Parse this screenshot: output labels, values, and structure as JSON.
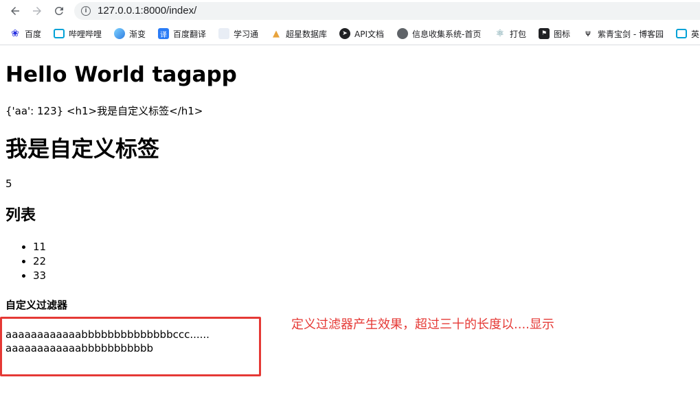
{
  "browser": {
    "url": "127.0.0.1:8000/index/",
    "bookmarks": [
      {
        "label": "百度",
        "icon": "baidu-paw-icon",
        "color": "#2932e1"
      },
      {
        "label": "哔哩哔哩",
        "icon": "bilibili-tv-icon",
        "color": "#00a1d6"
      },
      {
        "label": "渐变",
        "icon": "gradient-cube-icon",
        "color": "#4a90e2"
      },
      {
        "label": "百度翻译",
        "icon": "translate-icon",
        "color": "#2b7cf6"
      },
      {
        "label": "学习通",
        "icon": "blank-page-icon",
        "color": "#e8edf5"
      },
      {
        "label": "超星数据库",
        "icon": "chaoxing-logo-icon",
        "color": "#e8a33c"
      },
      {
        "label": "API文档",
        "icon": "compass-icon",
        "color": "#202124"
      },
      {
        "label": "信息收集系统-首页",
        "icon": "globe-icon",
        "color": "#5f6368"
      },
      {
        "label": "打包",
        "icon": "electron-icon",
        "color": "#47848f"
      },
      {
        "label": "图标",
        "icon": "flag-icon",
        "color": "#202124"
      },
      {
        "label": "紫青宝剑 - 博客园",
        "icon": "cnblogs-icon",
        "color": "#202124"
      },
      {
        "label": "英",
        "icon": "bilibili-tv-icon",
        "color": "#00a1d6"
      }
    ]
  },
  "page": {
    "title": "Hello World tagapp",
    "dict_line": "{'aa': 123} <h1>我是自定义标签</h1>",
    "custom_tag_heading": "我是自定义标签",
    "number": "5",
    "list_title": "列表",
    "list_items": [
      "11",
      "22",
      "33"
    ],
    "filter_title": "自定义过滤器",
    "filter_line1": "aaaaaaaaaaaabbbbbbbbbbbbbbccc......",
    "filter_line2": "aaaaaaaaaaaabbbbbbbbbbb"
  },
  "annotation": {
    "text": "定义过滤器产生效果，超过三十的长度以....显示",
    "color": "#e53935"
  }
}
